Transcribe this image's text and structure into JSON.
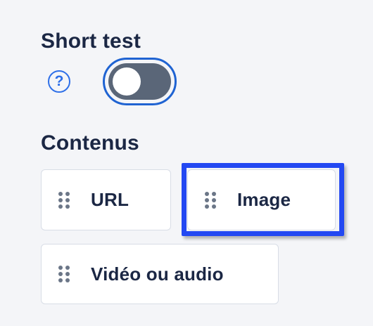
{
  "short_test": {
    "title": "Short test",
    "help_glyph": "?",
    "help_icon": "question-circle-icon",
    "toggle_on": false,
    "accent_color": "#1f63d2"
  },
  "contents": {
    "title": "Contenus",
    "items": [
      {
        "label": "URL",
        "icon": "drag-handle-icon"
      },
      {
        "label": "Image",
        "icon": "drag-handle-icon",
        "highlighted": true
      },
      {
        "label": "Vidéo ou audio",
        "icon": "drag-handle-icon"
      }
    ],
    "highlight_color": "#2348f2"
  }
}
